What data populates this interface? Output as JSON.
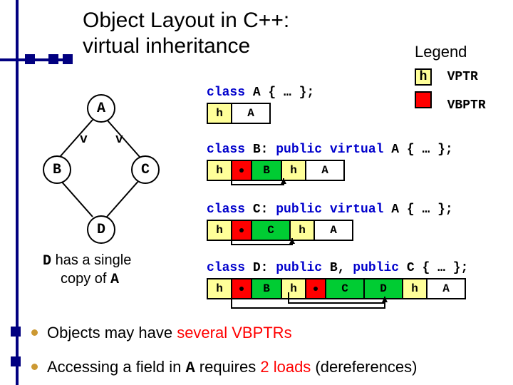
{
  "title_line1": "Object Layout in C++:",
  "title_line2": "virtual inheritance",
  "legend_title": "Legend",
  "legend_vptr": "VPTR",
  "legend_vbptr": "VBPTR",
  "legend_h": "h",
  "nodes": {
    "A": "A",
    "B": "B",
    "C": "C",
    "D": "D"
  },
  "vlabel": "v",
  "caption_1": "D",
  "caption_2": " has a single",
  "caption_3": "copy of ",
  "caption_4": "A",
  "decl_A": {
    "pre": "class",
    "post": " A { … };"
  },
  "row_A": [
    "h",
    "A"
  ],
  "decl_B": {
    "pre": "class",
    "mid": " B: ",
    "kw": "public virtual",
    "post": " A { … };"
  },
  "row_B": [
    "h",
    "●",
    "B",
    "h",
    "A"
  ],
  "decl_C": {
    "pre": "class",
    "mid": " C: ",
    "kw": "public virtual",
    "post": " A { … };"
  },
  "row_C": [
    "h",
    "●",
    "C",
    "h",
    "A"
  ],
  "decl_D": {
    "pre": "class",
    "mid": " D: ",
    "kw1": "public",
    "mid2": " B, ",
    "kw2": "public",
    "post": " C { … };"
  },
  "row_D": [
    "h",
    "●",
    "B",
    "h",
    "●",
    "C",
    "D",
    "h",
    "A"
  ],
  "bullet1_a": "Objects may have ",
  "bullet1_b": "several VBPTRs",
  "bullet2_a": "Accessing a field in ",
  "bullet2_A": "A",
  "bullet2_b": " requires ",
  "bullet2_c": "2 loads",
  "bullet2_d": " (dereferences)"
}
